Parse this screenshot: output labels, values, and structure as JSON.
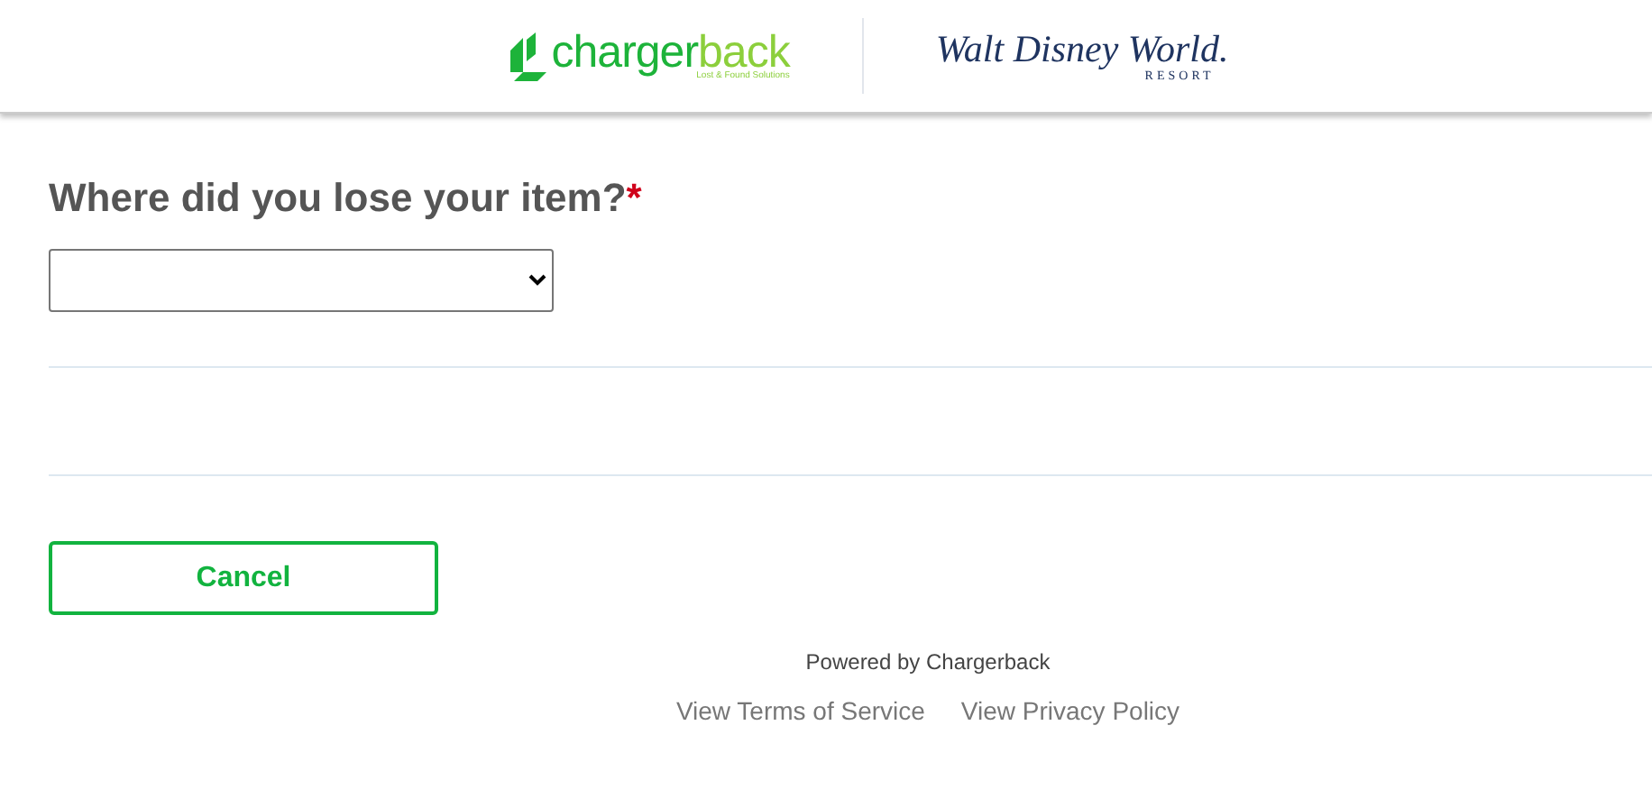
{
  "header": {
    "brand": {
      "part_1": "charger",
      "part_2": "back",
      "tagline": "Lost & Found Solutions"
    },
    "partner": {
      "name": "Walt Disney World.",
      "sub": "RESORT"
    }
  },
  "form": {
    "question": "Where did you lose your item?",
    "required_mark": "*"
  },
  "buttons": [
    {
      "label": "Cancel"
    }
  ],
  "footer": {
    "powered_by": "Powered by Chargerback",
    "links": [
      "View Terms of Service",
      "View Privacy Policy"
    ]
  }
}
